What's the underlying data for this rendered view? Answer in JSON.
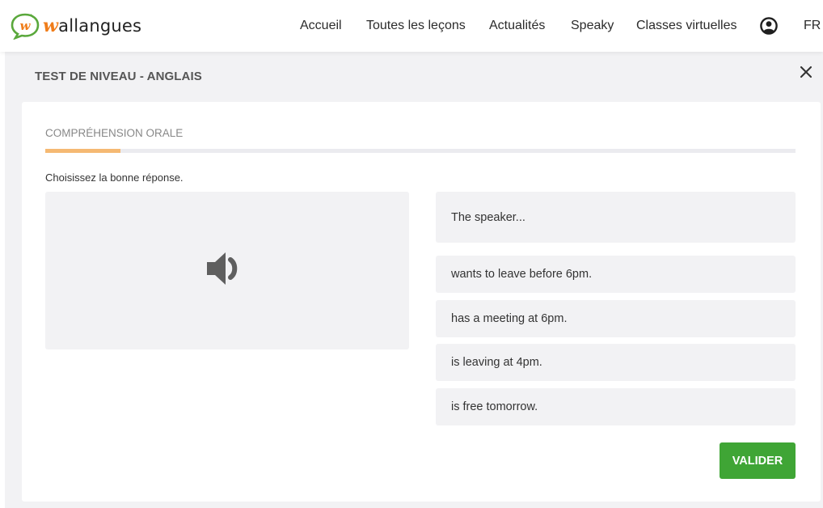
{
  "brand": {
    "logo_initial": "w",
    "name_rest": "allangues",
    "logo_icon": "speech-bubble-w-icon"
  },
  "nav": {
    "items": [
      {
        "label": "Accueil"
      },
      {
        "label": "Toutes les leçons"
      },
      {
        "label": "Actualités"
      },
      {
        "label": "Speaky"
      },
      {
        "label": "Classes virtuelles"
      }
    ],
    "user_icon": "user-circle-icon",
    "language": "FR"
  },
  "test": {
    "title": "TEST DE NIVEAU - ANGLAIS",
    "close_icon": "close-icon",
    "section": "COMPRÉHENSION ORALE",
    "progress": 0.1,
    "instruction": "Choisissez la bonne réponse.",
    "audio_icon": "speaker-volume-icon",
    "question": "The speaker...",
    "options": [
      {
        "label": "wants to leave before 6pm."
      },
      {
        "label": "has a meeting at 6pm."
      },
      {
        "label": "is leaving at 4pm."
      },
      {
        "label": "is free tomorrow."
      }
    ],
    "submit_label": "VALIDER"
  },
  "colors": {
    "brand_orange": "#f07d1a",
    "brand_green": "#5aa83c",
    "progress": "#f5b973",
    "submit": "#3fa535",
    "panel": "#f2f2f4"
  }
}
